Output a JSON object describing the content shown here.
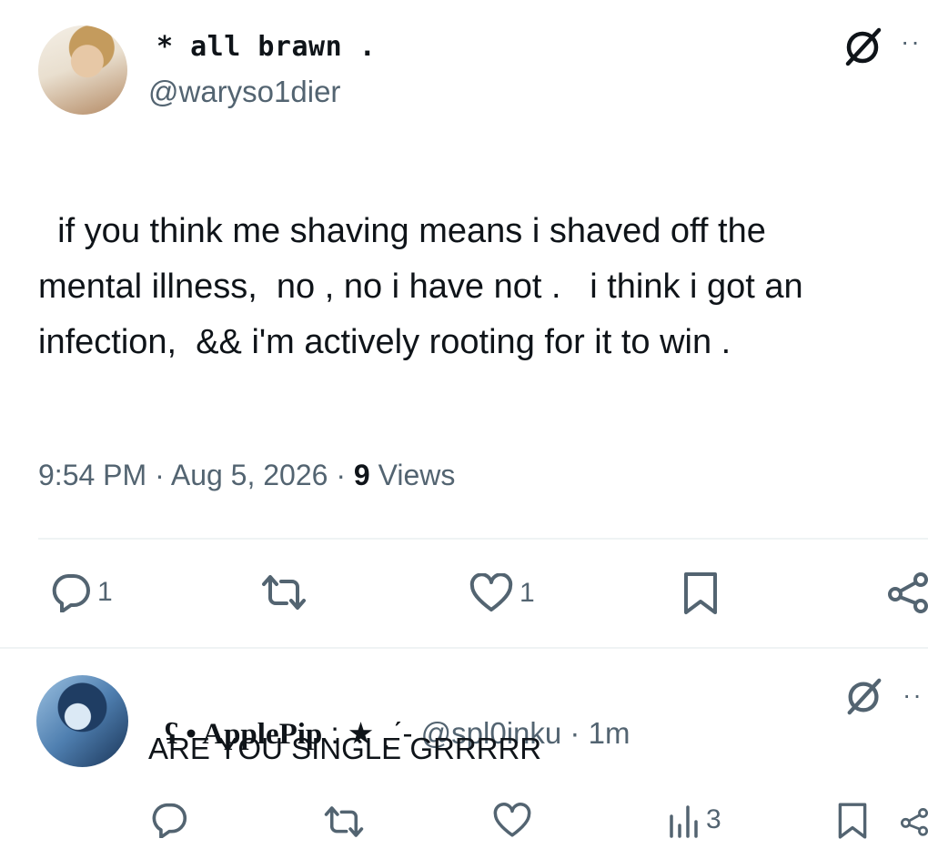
{
  "tweet": {
    "display_name": "* all brawn .",
    "handle": "@waryso1dier",
    "text": "  if you think me shaving means i shaved off the\nmental illness,  no , no i have not .   i think i got an\ninfection,  && i'm actively rooting for it to win .",
    "time": "9:54 PM",
    "sep1": " · ",
    "date": "Aug 5, 2026",
    "sep2": " · ",
    "views_count": "9",
    "views_label": " Views",
    "reply_count": "1",
    "like_count": "1"
  },
  "reply": {
    "display_prefix": "ʢ • ",
    "display_name": "ApplePip",
    "display_suffix": " : ★ ˎˊ-",
    "handle": " @spl0inku",
    "sep": " · ",
    "time": "1m",
    "text": "ARE YOU SINGLE GRRRRR",
    "views_count": "3"
  },
  "icons": {
    "grok": "grok-icon",
    "more": "more-icon",
    "reply": "reply-icon",
    "retweet": "retweet-icon",
    "like": "heart-icon",
    "bookmark": "bookmark-icon",
    "share": "share-icon",
    "views": "views-icon"
  },
  "colors": {
    "text": "#0f1419",
    "secondary": "#536471",
    "divider": "#eff3f4"
  },
  "more_glyph": "··"
}
